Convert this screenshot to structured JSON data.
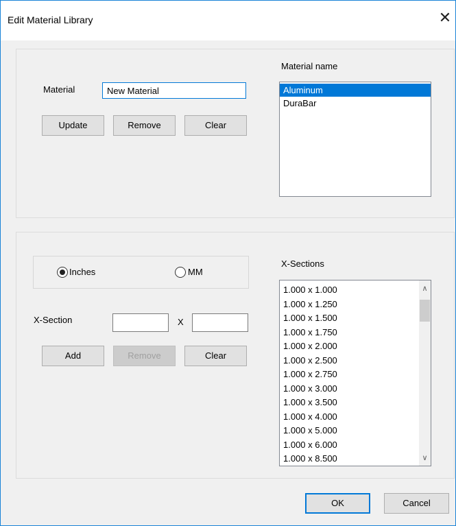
{
  "window": {
    "title": "Edit Material Library",
    "close_symbol": "✕"
  },
  "material_section": {
    "material_label": "Material",
    "material_value": "New Material",
    "buttons": {
      "update": "Update",
      "remove": "Remove",
      "clear": "Clear"
    },
    "list_header": "Material name",
    "materials": [
      {
        "name": "Aluminum",
        "selected": true
      },
      {
        "name": "DuraBar",
        "selected": false
      }
    ]
  },
  "xsection_section": {
    "units": [
      {
        "label": "Inches",
        "selected": true
      },
      {
        "label": "MM",
        "selected": false
      }
    ],
    "xsection_label": "X-Section",
    "x_separator": "X",
    "width_value": "",
    "height_value": "",
    "buttons": {
      "add": "Add",
      "remove": "Remove",
      "clear": "Clear"
    },
    "remove_disabled": true,
    "list_header": "X-Sections",
    "sections": [
      "1.000 x 1.000",
      "1.000 x 1.250",
      "1.000 x 1.500",
      "1.000 x 1.750",
      "1.000 x 2.000",
      "1.000 x 2.500",
      "1.000 x 2.750",
      "1.000 x 3.000",
      "1.000 x 3.500",
      "1.000 x 4.000",
      "1.000 x 5.000",
      "1.000 x 6.000",
      "1.000 x 8.500"
    ],
    "scroll_up_symbol": "∧",
    "scroll_down_symbol": "∨"
  },
  "footer": {
    "ok": "OK",
    "cancel": "Cancel"
  }
}
